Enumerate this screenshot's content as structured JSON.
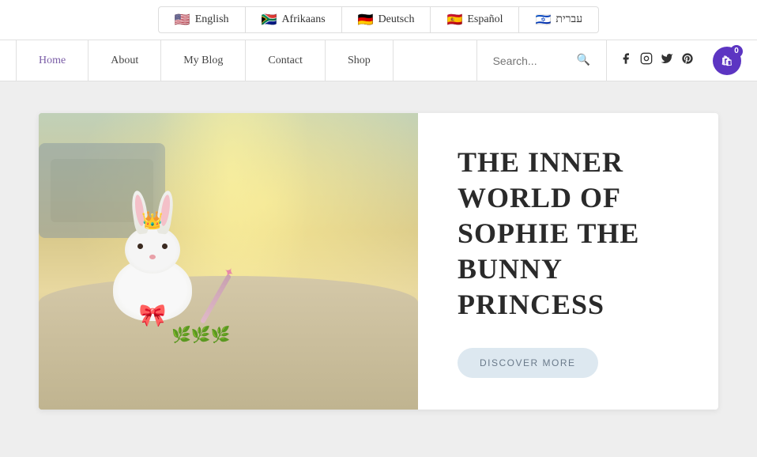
{
  "langBar": {
    "languages": [
      {
        "flag": "🇺🇸",
        "label": "English",
        "active": true
      },
      {
        "flag": "🇿🇦",
        "label": "Afrikaans",
        "active": false
      },
      {
        "flag": "🇩🇪",
        "label": "Deutsch",
        "active": false
      },
      {
        "flag": "🇪🇸",
        "label": "Español",
        "active": false
      },
      {
        "flag": "🇮🇱",
        "label": "עברית",
        "active": false
      }
    ]
  },
  "nav": {
    "links": [
      {
        "label": "Home",
        "active": true
      },
      {
        "label": "About",
        "active": false
      },
      {
        "label": "My Blog",
        "active": false
      },
      {
        "label": "Contact",
        "active": false
      },
      {
        "label": "Shop",
        "active": false
      }
    ],
    "search_placeholder": "Search...",
    "cart_count": "0"
  },
  "hero": {
    "title": "THE INNER WORLD OF SOPHIE THE BUNNY PRINCESS",
    "cta_label": "DISCOVER MORE"
  },
  "social": {
    "icons": [
      "f",
      "ig",
      "tw",
      "p"
    ]
  }
}
